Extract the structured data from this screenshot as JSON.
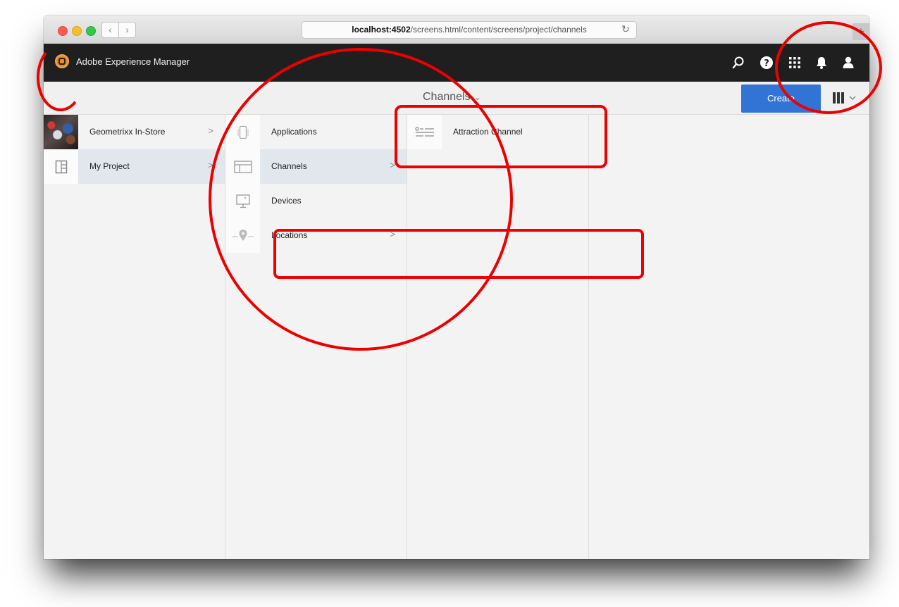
{
  "browser": {
    "url_host": "localhost:4502",
    "url_path": "/screens.html/content/screens/project/channels",
    "back_glyph": "‹",
    "forward_glyph": "›",
    "reload_glyph": "↻",
    "new_tab_glyph": "+"
  },
  "topnav": {
    "product_name": "Adobe Experience Manager",
    "icons": [
      "search-icon",
      "help-icon",
      "solutions-grid-icon",
      "notifications-bell-icon",
      "user-profile-icon"
    ]
  },
  "actionbar": {
    "title": "Channels",
    "title_chevron": "⌄",
    "create_label": "Create",
    "view_switch_chevron": "⌄"
  },
  "columns": {
    "projects": [
      {
        "label": "Geometrixx In-Store",
        "arrow": ">"
      },
      {
        "label": "My Project",
        "arrow": ">"
      }
    ],
    "project_folders": [
      {
        "label": "Applications",
        "arrow": ""
      },
      {
        "label": "Channels",
        "arrow": ">"
      },
      {
        "label": "Devices",
        "arrow": ""
      },
      {
        "label": "Locations",
        "arrow": ">"
      }
    ],
    "channels": [
      {
        "label": "Attraction Channel"
      }
    ]
  },
  "colors": {
    "nav_bg": "#1f1f1f",
    "primary_button": "#3174d6",
    "selected_row": "#e2e6ed",
    "annotation_red": "#ec0000"
  }
}
